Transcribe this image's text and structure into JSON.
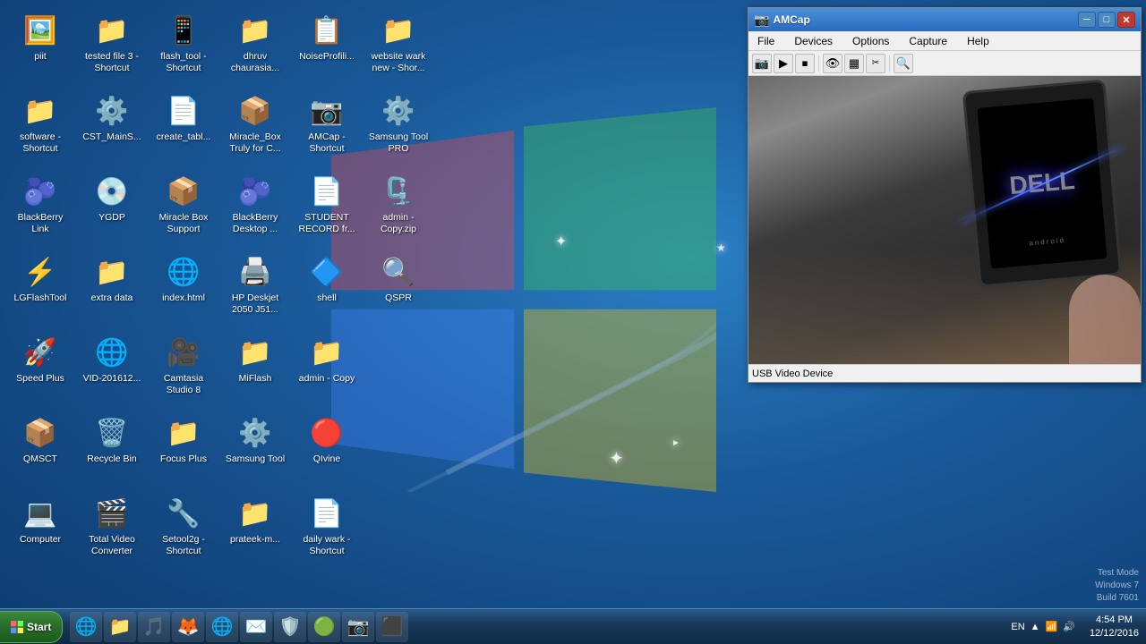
{
  "desktop": {
    "background_color": "#1a5a9a"
  },
  "icons": [
    {
      "id": "piit",
      "label": "piit",
      "emoji": "🖼️",
      "row": 0,
      "col": 0
    },
    {
      "id": "software-shortcut",
      "label": "software -\nShortcut",
      "emoji": "📁",
      "row": 1,
      "col": 0
    },
    {
      "id": "blackberry-link",
      "label": "BlackBerry\nLink",
      "emoji": "🫐",
      "row": 2,
      "col": 0
    },
    {
      "id": "lgflash",
      "label": "LGFlashTool",
      "emoji": "⚡",
      "row": 3,
      "col": 0
    },
    {
      "id": "speed-plus",
      "label": "Speed Plus",
      "emoji": "🚀",
      "row": 4,
      "col": 0
    },
    {
      "id": "qmsct",
      "label": "QMSCT",
      "emoji": "📦",
      "row": 5,
      "col": 0
    },
    {
      "id": "computer",
      "label": "Computer",
      "emoji": "💻",
      "row": 0,
      "col": 1
    },
    {
      "id": "tested-file",
      "label": "tested file 3 -\nShortcut",
      "emoji": "📁",
      "row": 1,
      "col": 1
    },
    {
      "id": "cst-main",
      "label": "CST_MainS...",
      "emoji": "⚙️",
      "row": 2,
      "col": 1
    },
    {
      "id": "ygdp",
      "label": "YGDP",
      "emoji": "💿",
      "row": 3,
      "col": 1
    },
    {
      "id": "extra-data",
      "label": "extra data",
      "emoji": "📁",
      "row": 4,
      "col": 1
    },
    {
      "id": "vid",
      "label": "VID-201612...",
      "emoji": "🌐",
      "row": 5,
      "col": 1
    },
    {
      "id": "recycle-bin",
      "label": "Recycle Bin",
      "emoji": "🗑️",
      "row": 0,
      "col": 2
    },
    {
      "id": "total-video",
      "label": "Total Video\nConverter",
      "emoji": "🎬",
      "row": 1,
      "col": 2
    },
    {
      "id": "flash-tool",
      "label": "flash_tool -\nShortcut",
      "emoji": "📱",
      "row": 2,
      "col": 2
    },
    {
      "id": "create-table",
      "label": "create_tabl...",
      "emoji": "📄",
      "row": 3,
      "col": 2
    },
    {
      "id": "miracle-box-support",
      "label": "Miracle Box\nSupport",
      "emoji": "📦",
      "row": 4,
      "col": 2
    },
    {
      "id": "index-html",
      "label": "index.html",
      "emoji": "🌐",
      "row": 5,
      "col": 2
    },
    {
      "id": "camtasia",
      "label": "Camtasia\nStudio 8",
      "emoji": "🎥",
      "row": 0,
      "col": 3
    },
    {
      "id": "focus-plus",
      "label": "Focus Plus",
      "emoji": "📁",
      "row": 1,
      "col": 3
    },
    {
      "id": "setool2g",
      "label": "Setool2g -\nShortcut",
      "emoji": "🔧",
      "row": 2,
      "col": 3
    },
    {
      "id": "dhruv",
      "label": "dhruv\nchaurasia...",
      "emoji": "📁",
      "row": 3,
      "col": 3
    },
    {
      "id": "miracle-box-truly",
      "label": "Miracle_Box\nTruly for C...",
      "emoji": "📦",
      "row": 4,
      "col": 3
    },
    {
      "id": "blackberry-desktop",
      "label": "BlackBerry\nDesktop ...",
      "emoji": "🫐",
      "row": 5,
      "col": 3
    },
    {
      "id": "hp-deskjet",
      "label": "HP Deskjet\n2050 J51...",
      "emoji": "🖨️",
      "row": 0,
      "col": 4
    },
    {
      "id": "miflash",
      "label": "MiFlash",
      "emoji": "📁",
      "row": 1,
      "col": 4
    },
    {
      "id": "samsung-tool",
      "label": "Samsung\nTool",
      "emoji": "⚙️",
      "row": 2,
      "col": 4
    },
    {
      "id": "prateek-m",
      "label": "prateek-m...",
      "emoji": "📁",
      "row": 3,
      "col": 4
    },
    {
      "id": "noise-profiling",
      "label": "NoiseProfili...",
      "emoji": "📋",
      "row": 4,
      "col": 4
    },
    {
      "id": "amcap-shortcut",
      "label": "AMCap -\nShortcut",
      "emoji": "📷",
      "row": 0,
      "col": 5
    },
    {
      "id": "student-record",
      "label": "STUDENT\nRECORD fr...",
      "emoji": "📄",
      "row": 1,
      "col": 5
    },
    {
      "id": "shell",
      "label": "shell",
      "emoji": "🔷",
      "row": 2,
      "col": 5
    },
    {
      "id": "admin-copy",
      "label": "admin -\nCopy",
      "emoji": "📁",
      "row": 3,
      "col": 5
    },
    {
      "id": "qivine",
      "label": "QIvine",
      "emoji": "🔴",
      "row": 4,
      "col": 5
    },
    {
      "id": "daily-wark",
      "label": "daily wark -\nShortcut",
      "emoji": "📄",
      "row": 0,
      "col": 6
    },
    {
      "id": "website-wark",
      "label": "website wark\nnew - Shor...",
      "emoji": "📁",
      "row": 1,
      "col": 6
    },
    {
      "id": "samsung-tool-pro",
      "label": "Samsung\nTool PRO",
      "emoji": "⚙️",
      "row": 2,
      "col": 6
    },
    {
      "id": "admin-copyzip",
      "label": "admin -\nCopy.zip",
      "emoji": "🗜️",
      "row": 3,
      "col": 6
    },
    {
      "id": "qspr",
      "label": "QSPR",
      "emoji": "🔍",
      "row": 4,
      "col": 6
    }
  ],
  "amcap_window": {
    "title": "AMCap",
    "menu_items": [
      "File",
      "Devices",
      "Options",
      "Capture",
      "Help"
    ],
    "status_bar": "USB Video Device",
    "toolbar_icons": [
      "📷",
      "▶",
      "⏹",
      "👁",
      "▦",
      "✂",
      "🔍"
    ]
  },
  "taskbar": {
    "start_label": "Start",
    "apps": [
      "🌐",
      "📁",
      "🌊",
      "🌐",
      "📧",
      "🛡️",
      "🎨",
      "📷",
      "🖥️"
    ],
    "time": "4:54 PM",
    "date": "12/12/2016",
    "lang": "EN"
  },
  "test_mode": {
    "line1": "Test Mode",
    "line2": "Windows 7",
    "line3": "Build 7601"
  }
}
